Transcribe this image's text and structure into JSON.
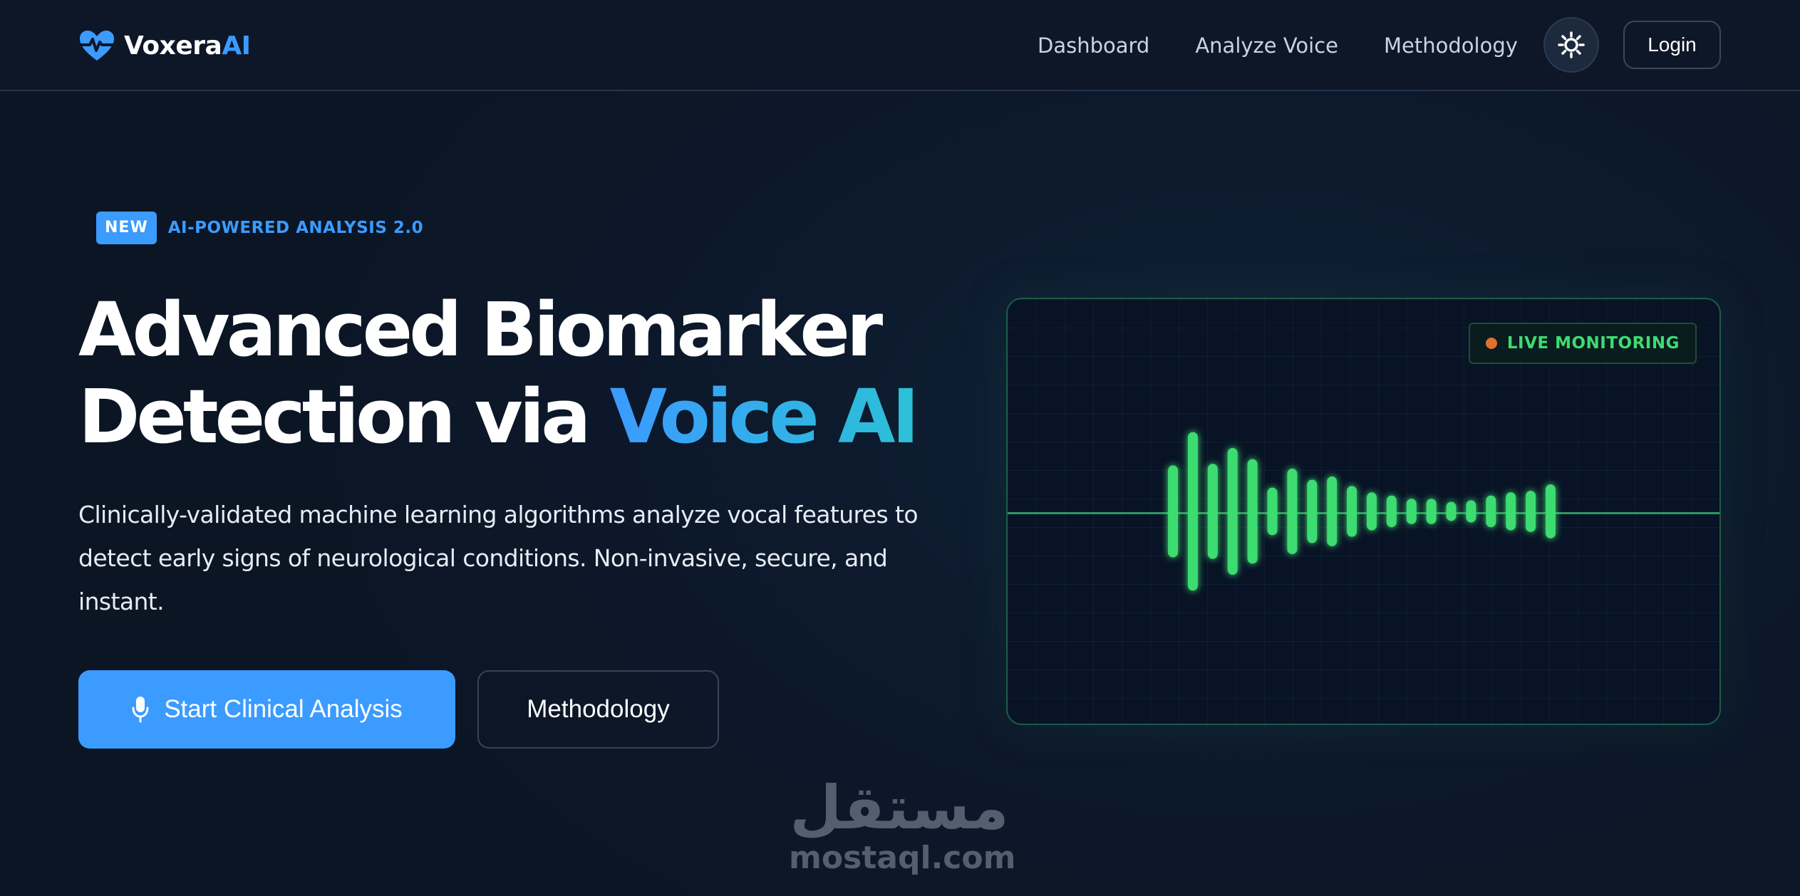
{
  "header": {
    "brand_name": "Voxera",
    "brand_accent": "AI",
    "brand_icon": "heart-pulse-icon",
    "nav": [
      "Dashboard",
      "Analyze Voice",
      "Methodology"
    ],
    "theme_toggle_icon": "sun-icon",
    "login_label": "Login"
  },
  "hero": {
    "badge_new": "NEW",
    "badge_text": "AI-POWERED ANALYSIS 2.0",
    "title_line1": "Advanced Biomarker",
    "title_line2_plain": "Detection via",
    "title_line2_accent": "Voice AI",
    "description": "Clinically-validated machine learning algorithms analyze vocal features to detect early signs of neurological conditions. Non-invasive, secure, and instant.",
    "primary_button": "Start Clinical Analysis",
    "primary_button_icon": "microphone-icon",
    "secondary_button": "Methodology"
  },
  "monitor": {
    "status_label": "LIVE MONITORING",
    "waveform_levels": [
      0.58,
      1.0,
      0.6,
      0.8,
      0.66,
      0.3,
      0.54,
      0.4,
      0.44,
      0.32,
      0.24,
      0.2,
      0.16,
      0.16,
      0.12,
      0.14,
      0.2,
      0.24,
      0.26,
      0.34
    ]
  },
  "watermark": {
    "arabic": "مستقل",
    "latin": "mostaql.com"
  },
  "colors": {
    "accent_blue": "#3b9bff",
    "accent_teal": "#2bc1d6",
    "wave_green": "#3ddc71",
    "live_dot": "#e0702c",
    "background": "#0d1a2d"
  }
}
